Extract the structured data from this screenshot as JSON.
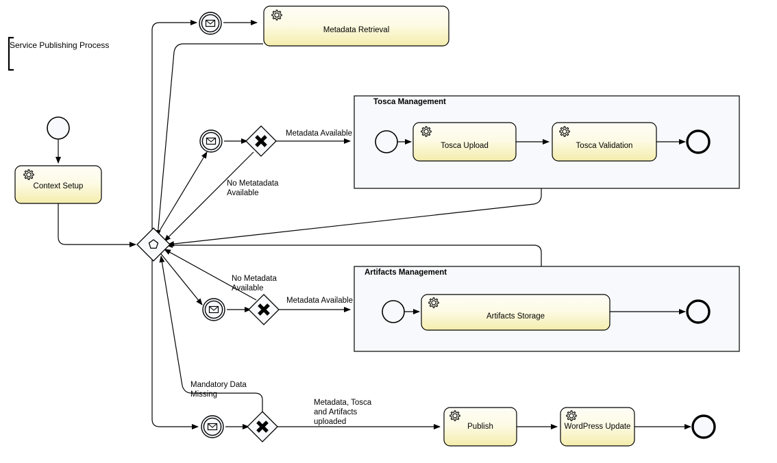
{
  "diagram": {
    "title": "Service Publishing Process",
    "type": "bpmn-collaboration-diagram"
  },
  "pools": [
    {
      "id": "tosca",
      "title": "Tosca Management"
    },
    {
      "id": "artifacts",
      "title": "Artifacts Management"
    }
  ],
  "tasks": [
    {
      "id": "metadata_retrieval",
      "label": "Metadata Retrieval",
      "icon": "gear-icon",
      "type": "service-task"
    },
    {
      "id": "context_setup",
      "label": "Context Setup",
      "icon": "gear-icon",
      "type": "service-task"
    },
    {
      "id": "tosca_upload",
      "label": "Tosca Upload",
      "icon": "gear-icon",
      "type": "service-task"
    },
    {
      "id": "tosca_validation",
      "label": "Tosca Validation",
      "icon": "gear-icon",
      "type": "service-task"
    },
    {
      "id": "artifacts_storage",
      "label": "Artifacts Storage",
      "icon": "gear-icon",
      "type": "service-task"
    },
    {
      "id": "publish",
      "label": "Publish",
      "icon": "gear-icon",
      "type": "service-task"
    },
    {
      "id": "wordpress_update",
      "label": "WordPress Update",
      "icon": "gear-icon",
      "type": "service-task"
    }
  ],
  "flow_labels": [
    {
      "id": "metadata_available_tosca",
      "text": "Metadata Available"
    },
    {
      "id": "no_metatadata_available",
      "text": "No Metatadata\nAvailable"
    },
    {
      "id": "no_metadata_available",
      "text": "No Metadata\nAvailable"
    },
    {
      "id": "metadata_available_artifacts",
      "text": "Metadata Available"
    },
    {
      "id": "mandatory_data_missing",
      "text": "Mandatory Data\nMissing"
    },
    {
      "id": "all_uploaded",
      "text": "Metadata, Tosca\nand Artifacts\nuploaded"
    }
  ],
  "events": [
    {
      "id": "start_event_main",
      "type": "start-event"
    },
    {
      "id": "message_event_metadata",
      "type": "intermediate-message-event",
      "icon": "envelope-icon"
    },
    {
      "id": "message_event_tosca",
      "type": "intermediate-message-event",
      "icon": "envelope-icon"
    },
    {
      "id": "message_event_artifacts",
      "type": "intermediate-message-event",
      "icon": "envelope-icon"
    },
    {
      "id": "message_event_publish",
      "type": "intermediate-message-event",
      "icon": "envelope-icon"
    },
    {
      "id": "start_event_tosca",
      "type": "start-event"
    },
    {
      "id": "end_event_tosca",
      "type": "end-event"
    },
    {
      "id": "start_event_artifacts",
      "type": "start-event"
    },
    {
      "id": "end_event_artifacts",
      "type": "end-event"
    },
    {
      "id": "end_event_main",
      "type": "end-event"
    }
  ],
  "gateways": [
    {
      "id": "complex_gateway",
      "type": "complex-gateway",
      "icon": "pentagon-icon"
    },
    {
      "id": "exclusive_gateway_tosca",
      "type": "exclusive-gateway",
      "icon": "x-icon"
    },
    {
      "id": "exclusive_gateway_artifacts",
      "type": "exclusive-gateway",
      "icon": "x-icon"
    },
    {
      "id": "exclusive_gateway_publish",
      "type": "exclusive-gateway",
      "icon": "x-icon"
    }
  ],
  "colors": {
    "task_fill_top": "#fdfcf0",
    "task_fill_bottom": "#f6efb4",
    "pool_fill": "#f7f9fc",
    "event_fill": "#f7f9fc",
    "stroke": "#000000"
  }
}
